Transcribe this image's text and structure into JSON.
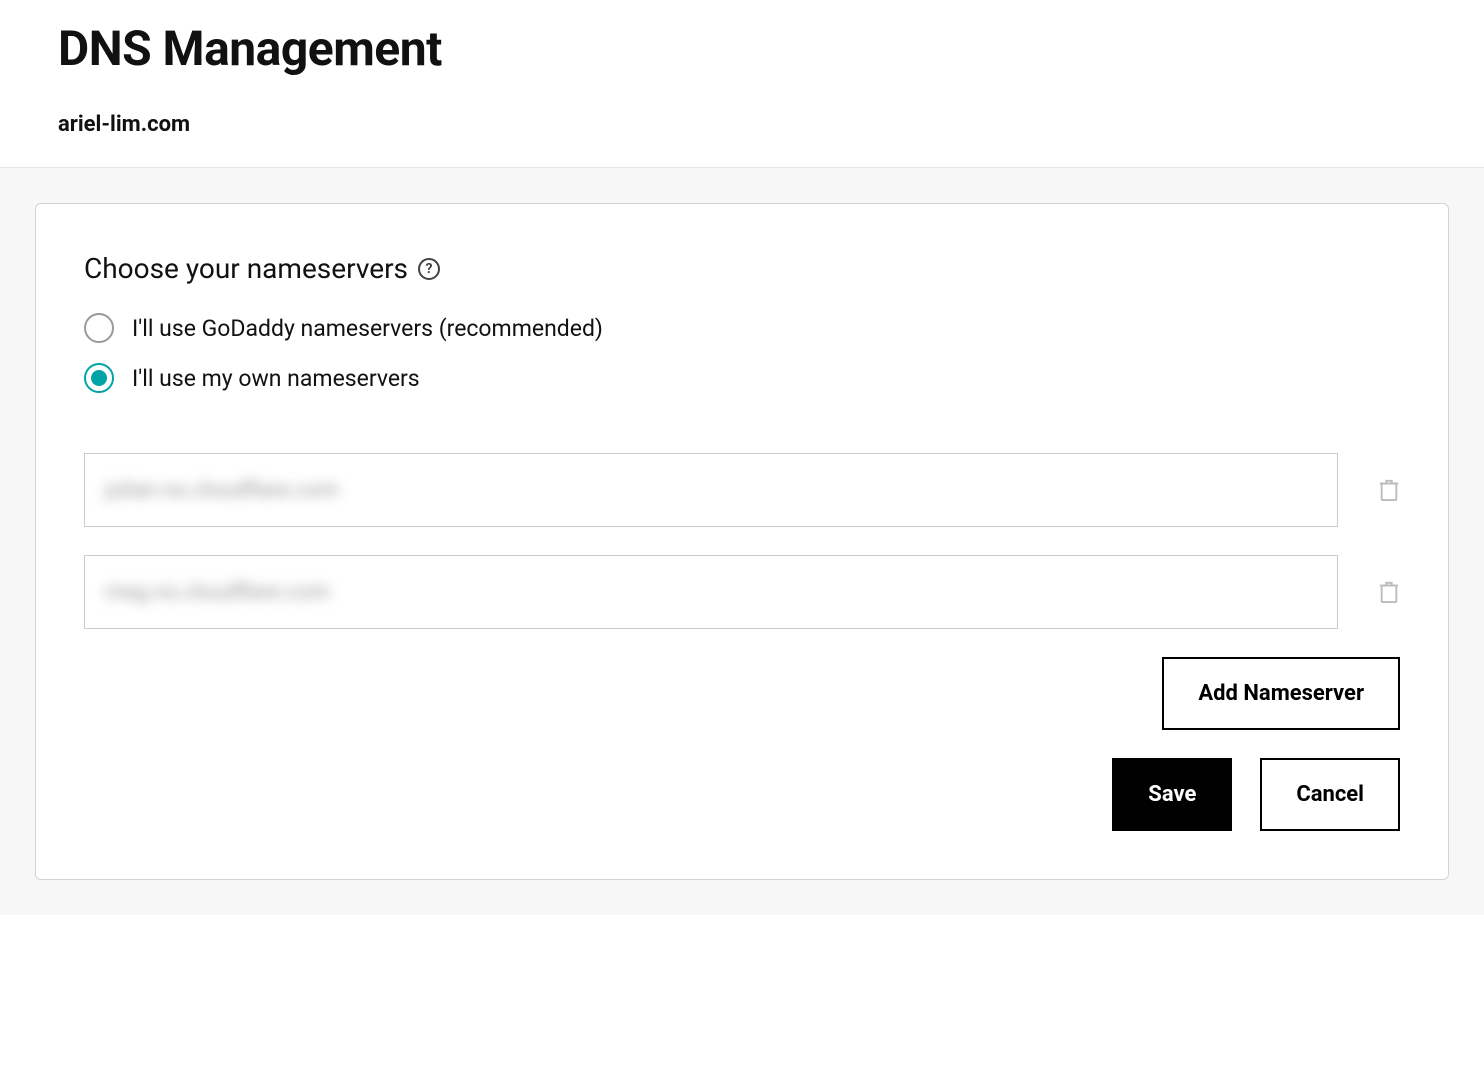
{
  "header": {
    "title": "DNS Management",
    "domain": "ariel-lim.com"
  },
  "nameservers": {
    "section_title": "Choose your nameservers",
    "options": {
      "godaddy": "I'll use GoDaddy nameservers (recommended)",
      "own": "I'll use my own nameservers"
    },
    "selected": "own",
    "entries": [
      "julian.ns.cloudflare.com",
      "meg.ns.cloudflare.com"
    ]
  },
  "buttons": {
    "add": "Add Nameserver",
    "save": "Save",
    "cancel": "Cancel"
  }
}
